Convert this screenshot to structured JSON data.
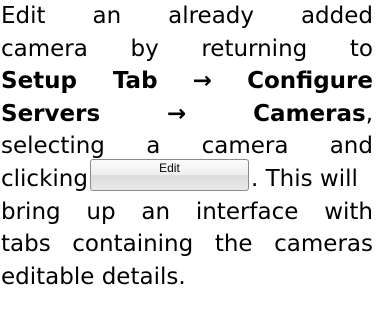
{
  "paragraph": {
    "line1": "Edit an already added",
    "line2": "camera by returning to",
    "line3a": "Setup Tab",
    "arrow1": "→",
    "line3b": "Configure",
    "line4a": "Servers",
    "arrow2": "→",
    "line4b": "Cameras",
    "line4c": ",",
    "line5": "selecting a camera and",
    "line6a": "clicking",
    "button_label": "Edit",
    "line6b": ". This will",
    "line7": "bring up an interface with",
    "line8": "tabs containing the cameras",
    "line9": "editable details."
  }
}
